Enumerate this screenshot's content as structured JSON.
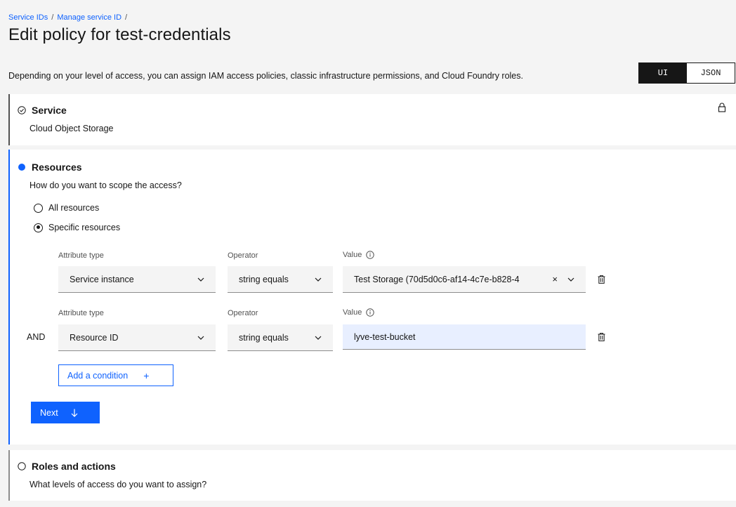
{
  "breadcrumb": {
    "items": [
      "Service IDs",
      "Manage service ID"
    ],
    "separator": "/"
  },
  "page": {
    "title": "Edit policy for test-credentials",
    "description": "Depending on your level of access, you can assign IAM access policies, classic infrastructure permissions, and Cloud Foundry roles."
  },
  "view_toggle": {
    "options": [
      "UI",
      "JSON"
    ],
    "selected": "UI"
  },
  "service": {
    "heading": "Service",
    "value": "Cloud Object Storage",
    "status_icon": "checkmark-outline-icon",
    "lock_icon": "lock-icon"
  },
  "resources": {
    "heading": "Resources",
    "question": "How do you want to scope the access?",
    "options": [
      "All resources",
      "Specific resources"
    ],
    "selected": "Specific resources",
    "labels": {
      "attribute_type": "Attribute type",
      "operator": "Operator",
      "value": "Value"
    },
    "conditions": [
      {
        "conjunction": "",
        "attribute_type": "Service instance",
        "operator": "string equals",
        "value": "Test Storage (70d5d0c6-af14-4c7e-b828-4"
      },
      {
        "conjunction": "AND",
        "attribute_type": "Resource ID",
        "operator": "string equals",
        "value": "lyve-test-bucket"
      }
    ],
    "add_condition": "Add a condition",
    "add_symbol": "+",
    "clear_symbol": "×",
    "next": "Next"
  },
  "roles": {
    "heading": "Roles and actions",
    "question": "What levels of access do you want to assign?"
  },
  "colors": {
    "accent": "#0f62fe",
    "text": "#161616",
    "background": "#f4f4f4",
    "input_highlight": "#e8efff"
  }
}
